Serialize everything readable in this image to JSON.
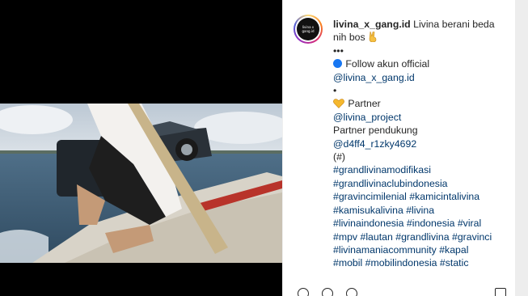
{
  "post": {
    "username": "livina_x_gang.id",
    "avatar_text": "livina x gang.id",
    "caption_lines": [
      {
        "text": "Livina berani beda",
        "kind": "text"
      },
      {
        "text": "nih bos",
        "kind": "text"
      },
      {
        "text": "•••",
        "kind": "text"
      },
      {
        "text": "Follow akun official",
        "kind": "text"
      },
      {
        "text": "@livina_x_gang.id",
        "kind": "link"
      },
      {
        "text": "•",
        "kind": "text"
      },
      {
        "text": "Partner",
        "kind": "text"
      },
      {
        "text": "@livina_project",
        "kind": "link"
      },
      {
        "text": "Partner pendukung",
        "kind": "text"
      },
      {
        "text": "@d4ff4_r1zky4692",
        "kind": "link"
      },
      {
        "text": "(#)",
        "kind": "text"
      },
      {
        "text": "#grandlivinamodifikasi",
        "kind": "link"
      },
      {
        "text": "#grandlivinaclubindonesia",
        "kind": "link"
      },
      {
        "text": "#gravincimilenial #kamicintalivina",
        "kind": "link"
      },
      {
        "text": "#kamisukalivina #livina",
        "kind": "link"
      },
      {
        "text": "#livinaindonesia #indonesia #viral",
        "kind": "link"
      },
      {
        "text": "#mpv #lautan #grandlivina #gravinci",
        "kind": "link"
      },
      {
        "text": "#livinamaniacommunity #kapal",
        "kind": "link"
      },
      {
        "text": "#mobil #mobilindonesia #static",
        "kind": "link"
      }
    ]
  },
  "icons": {
    "blue_circle": "blue-circle-emoji",
    "heart": "yellow-heart-emoji",
    "hand": "victory-hand-emoji"
  },
  "colors": {
    "link": "#00376b",
    "text": "#262626",
    "blue_dot": "#1877f2",
    "heart": "#f5b82e"
  }
}
